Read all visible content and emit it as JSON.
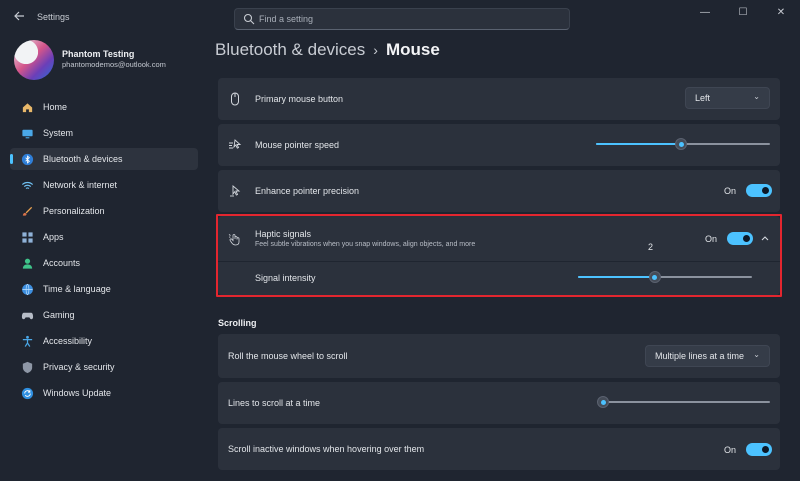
{
  "window": {
    "app_title": "Settings",
    "controls": {
      "minimize": "—",
      "maximize": "☐",
      "close": "✕"
    }
  },
  "search": {
    "placeholder": "Find a setting",
    "icon": "search-icon"
  },
  "profile": {
    "name": "Phantom Testing",
    "email": "phantomodemos@outlook.com"
  },
  "nav": [
    {
      "label": "Home",
      "icon": "home-icon",
      "active": false
    },
    {
      "label": "System",
      "icon": "system-icon",
      "active": false
    },
    {
      "label": "Bluetooth & devices",
      "icon": "bluetooth-icon",
      "active": true
    },
    {
      "label": "Network & internet",
      "icon": "network-icon",
      "active": false
    },
    {
      "label": "Personalization",
      "icon": "personalization-icon",
      "active": false
    },
    {
      "label": "Apps",
      "icon": "apps-icon",
      "active": false
    },
    {
      "label": "Accounts",
      "icon": "accounts-icon",
      "active": false
    },
    {
      "label": "Time & language",
      "icon": "time-language-icon",
      "active": false
    },
    {
      "label": "Gaming",
      "icon": "gaming-icon",
      "active": false
    },
    {
      "label": "Accessibility",
      "icon": "accessibility-icon",
      "active": false
    },
    {
      "label": "Privacy & security",
      "icon": "privacy-icon",
      "active": false
    },
    {
      "label": "Windows Update",
      "icon": "windows-update-icon",
      "active": false
    }
  ],
  "breadcrumb": {
    "parent": "Bluetooth & devices",
    "separator": "›",
    "current": "Mouse"
  },
  "settings": {
    "primary_button": {
      "label": "Primary mouse button",
      "value": "Left"
    },
    "pointer_speed": {
      "label": "Mouse pointer speed",
      "level": 0.49
    },
    "pointer_precision": {
      "label": "Enhance pointer precision",
      "state": "On"
    },
    "haptic": {
      "label": "Haptic signals",
      "description": "Feel subtle vibrations when you snap windows, align objects, and more",
      "state": "On"
    },
    "signal_intensity": {
      "label": "Signal intensity",
      "value": "2",
      "level": 0.44
    }
  },
  "scrolling": {
    "section_title": "Scrolling",
    "roll_wheel": {
      "label": "Roll the mouse wheel to scroll",
      "value": "Multiple lines at a time"
    },
    "lines": {
      "label": "Lines to scroll at a time",
      "level": 0.03
    },
    "inactive": {
      "label": "Scroll inactive windows when hovering over them",
      "state": "On"
    }
  },
  "colors": {
    "accent": "#4cc2ff",
    "highlight_border": "#e3262f",
    "background": "#1f2530",
    "card": "#2b313c"
  }
}
